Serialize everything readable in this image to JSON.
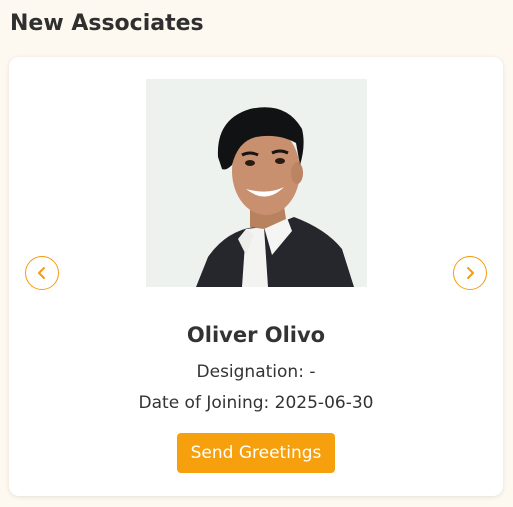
{
  "section": {
    "title": "New Associates"
  },
  "associate": {
    "name": "Oliver Olivo",
    "designation": "Designation: -",
    "date_of_joining": "Date of Joining: 2025-06-30",
    "photo_icon": "person-photo"
  },
  "actions": {
    "greet_label": "Send Greetings",
    "prev_icon": "chevron-left-icon",
    "next_icon": "chevron-right-icon"
  },
  "colors": {
    "accent": "#f7a00e",
    "page_background": "#fdf8f0",
    "card_background": "#ffffff",
    "text": "#333333"
  }
}
